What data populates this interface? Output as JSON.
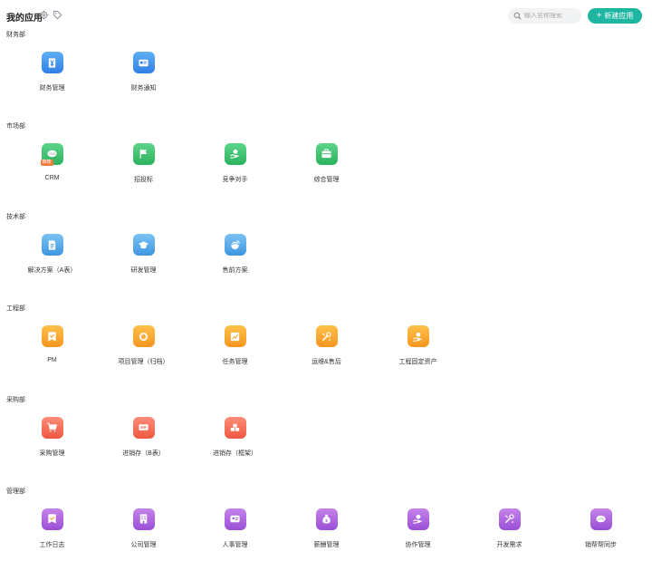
{
  "header": {
    "title": "我的应用",
    "search_placeholder": "输入名称搜索",
    "new_button_label": "新建应用"
  },
  "sections": [
    {
      "title": "财务部",
      "color": "#2f7fe6",
      "apps": [
        {
          "label": "财务管理",
          "icon": "yen-icon"
        },
        {
          "label": "财务通知",
          "icon": "notice-card-icon"
        }
      ]
    },
    {
      "title": "市场部",
      "color": "#2bb15d",
      "apps": [
        {
          "label": "CRM",
          "icon": "crm-icon",
          "badge": "推荐"
        },
        {
          "label": "招投标",
          "icon": "flag-icon"
        },
        {
          "label": "竞争对手",
          "icon": "hand-icon"
        },
        {
          "label": "综合管理",
          "icon": "briefcase-icon"
        }
      ]
    },
    {
      "title": "技术部",
      "color": "#3e96e0",
      "apps": [
        {
          "label": "解决方案（A表）",
          "icon": "document-icon"
        },
        {
          "label": "研发管理",
          "icon": "graduation-cap-icon"
        },
        {
          "label": "售前方案",
          "icon": "globe-icon"
        }
      ]
    },
    {
      "title": "工程部",
      "color": "#f5961e",
      "apps": [
        {
          "label": "PM",
          "icon": "checklist-icon"
        },
        {
          "label": "项目管理（归档）",
          "icon": "circle-icon"
        },
        {
          "label": "任务管理",
          "icon": "chart-icon"
        },
        {
          "label": "运维&售后",
          "icon": "wrench-icon"
        },
        {
          "label": "工程固定资产",
          "icon": "hand-icon"
        }
      ]
    },
    {
      "title": "采购部",
      "color": "#ee5740",
      "apps": [
        {
          "label": "采购管理",
          "icon": "cart-icon"
        },
        {
          "label": "进销存（B表）",
          "icon": "erp-icon"
        },
        {
          "label": "进销存（框架）",
          "icon": "boxes-icon"
        }
      ]
    },
    {
      "title": "管理部",
      "color": "#9a4fd6",
      "apps": [
        {
          "label": "工作日志",
          "icon": "checklist-icon"
        },
        {
          "label": "公司管理",
          "icon": "building-icon"
        },
        {
          "label": "人事管理",
          "icon": "id-card-icon"
        },
        {
          "label": "薪酬管理",
          "icon": "money-bag-icon"
        },
        {
          "label": "协作管理",
          "icon": "hand-icon"
        },
        {
          "label": "开发需求",
          "icon": "wrench-icon"
        },
        {
          "label": "销帮帮同步",
          "icon": "crm-icon"
        }
      ]
    }
  ]
}
